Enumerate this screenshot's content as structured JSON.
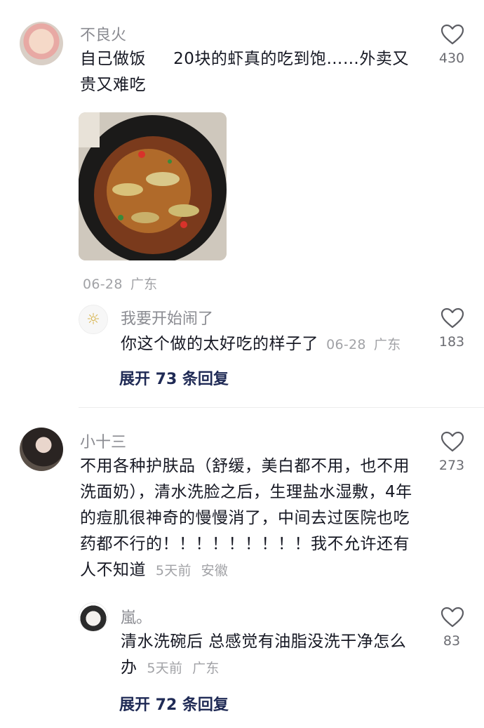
{
  "comments": [
    {
      "username": "不良火",
      "text": "自己做饭 　 20块的虾真的吃到饱……外卖又贵又难吃",
      "date": "06-28",
      "location": "广东",
      "likes": "430",
      "reply": {
        "username": "我要开始闹了",
        "text": "你这个做的太好吃的样子了",
        "date": "06-28",
        "location": "广东",
        "likes": "183"
      },
      "expand_label": "展开 73 条回复"
    },
    {
      "username": "小十三",
      "text": "不用各种护肤品（舒缓，美白都不用，也不用洗面奶），清水洗脸之后，生理盐水湿敷，4年的痘肌很神奇的慢慢消了，中间去过医院也吃药都不行的！！！！！！！！！我不允许还有人不知道",
      "date": "5天前",
      "location": "安徽",
      "likes": "273",
      "reply": {
        "username": "嵐。",
        "text": "清水洗碗后 总感觉有油脂没洗干净怎么办",
        "date": "5天前",
        "location": "广东",
        "likes": "83"
      },
      "expand_label": "展开 72 条回复"
    }
  ]
}
